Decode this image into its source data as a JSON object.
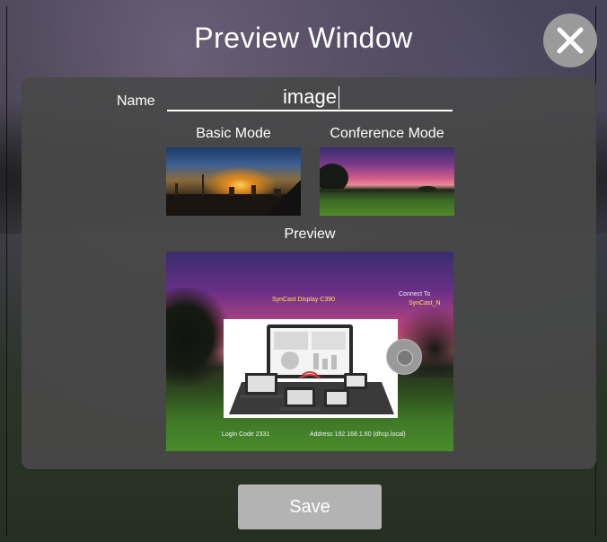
{
  "window": {
    "title": "Preview Window"
  },
  "form": {
    "name_label": "Name",
    "name_value": "image"
  },
  "modes": {
    "basic_label": "Basic Mode",
    "conference_label": "Conference Mode",
    "selected": "basic"
  },
  "preview": {
    "label": "Preview",
    "overlay_title": "SynCast Display C390",
    "overlay_connect": "Connect To",
    "overlay_ssid": "SynCast_N",
    "overlay_login": "Login Code 2331",
    "overlay_address": "Address 192.168.1.60 (dhcp.local)"
  },
  "actions": {
    "save_label": "Save"
  },
  "icons": {
    "close": "close-icon",
    "wheel": "navigation-wheel-icon"
  },
  "colors": {
    "panel": "#484848",
    "button": "#b3b3b3",
    "text": "#ffffff",
    "overlay_text": "#ffe45a"
  }
}
